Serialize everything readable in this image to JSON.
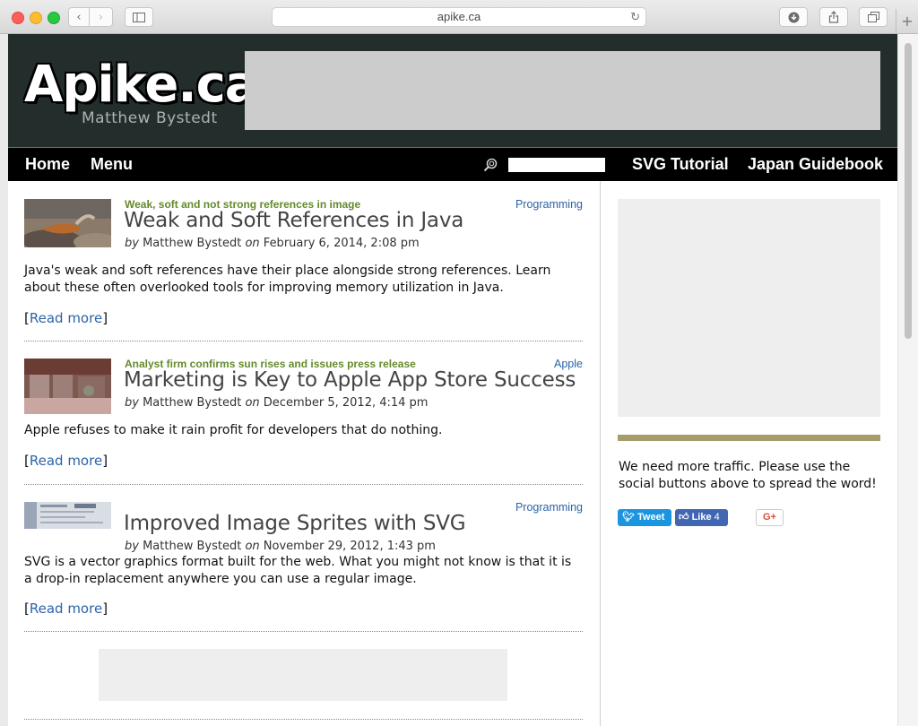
{
  "browser": {
    "url": "apike.ca",
    "new_tab_glyph": "+"
  },
  "header": {
    "logo": "Apike.ca",
    "tagline": "Matthew Bystedt"
  },
  "nav": {
    "left": [
      "Home",
      "Menu"
    ],
    "right": [
      "SVG Tutorial",
      "Japan Guidebook"
    ]
  },
  "posts": [
    {
      "kicker": "Weak, soft and not strong references in image",
      "category": "Programming",
      "title": "Weak and Soft References in Java",
      "by": "by",
      "author": "Matthew Bystedt",
      "on": "on",
      "date": "February 6, 2014, 2:08 pm",
      "excerpt": "Java's weak and soft references have their place alongside strong references. Learn about these often overlooked tools for improving memory utilization in Java.",
      "read_open": "[",
      "read_more": "Read more",
      "read_close": "]"
    },
    {
      "kicker": "Analyst firm confirms sun rises and issues press release",
      "category": "Apple",
      "title": "Marketing is Key to Apple App Store Success",
      "by": "by",
      "author": "Matthew Bystedt",
      "on": "on",
      "date": "December 5, 2012, 4:14 pm",
      "excerpt": "Apple refuses to make it rain profit for developers that do nothing.",
      "read_open": "[",
      "read_more": "Read more",
      "read_close": "]"
    },
    {
      "kicker": "",
      "category": "Programming",
      "title": "Improved Image Sprites with SVG",
      "by": "by",
      "author": "Matthew Bystedt",
      "on": "on",
      "date": "November 29, 2012, 1:43 pm",
      "excerpt": "SVG is a vector graphics format built for the web. What you might not know is that it is a drop-in replacement anywhere you can use a regular image.",
      "read_open": "[",
      "read_more": "Read more",
      "read_close": "]"
    }
  ],
  "sidebar": {
    "message": "We need more traffic. Please use the social buttons above to spread the word!",
    "tweet": "Tweet",
    "like": "Like",
    "like_count": "4",
    "gplus": "G+"
  },
  "colors": {
    "header_bg": "#222d2c",
    "nav_bg": "#000000",
    "kicker": "#658a2c",
    "link": "#2c63a8",
    "sidebar_rule": "#a79c6b"
  }
}
